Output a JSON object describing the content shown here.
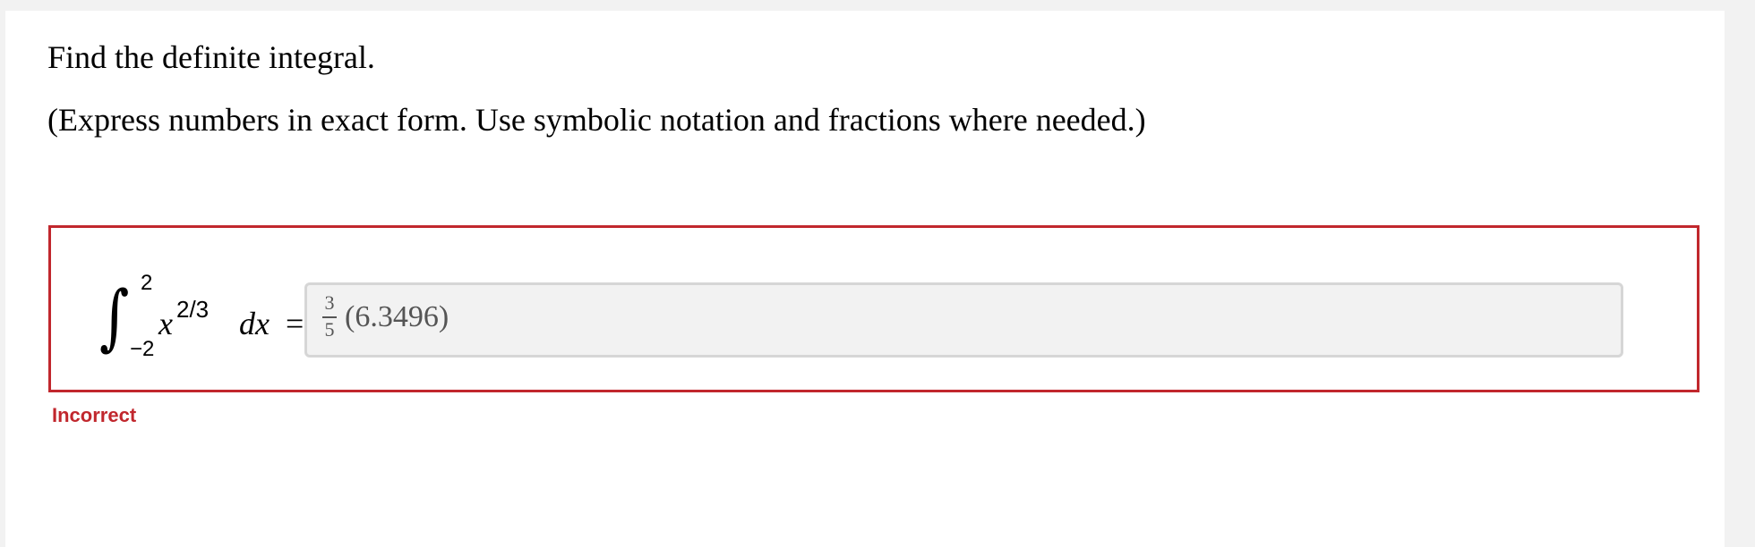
{
  "question": {
    "title": "Find the definite integral.",
    "instructions": "(Express numbers in exact form. Use symbolic notation and fractions where needed.)"
  },
  "integral": {
    "upper_limit": "2",
    "lower_limit": "−2",
    "integrand_base": "x",
    "integrand_exponent": "2/3",
    "differential": "dx",
    "equals": "="
  },
  "answer": {
    "fraction_numerator": "3",
    "fraction_denominator": "5",
    "remainder": "(6.3496)"
  },
  "feedback": {
    "status": "Incorrect",
    "status_color": "#c1272d"
  }
}
